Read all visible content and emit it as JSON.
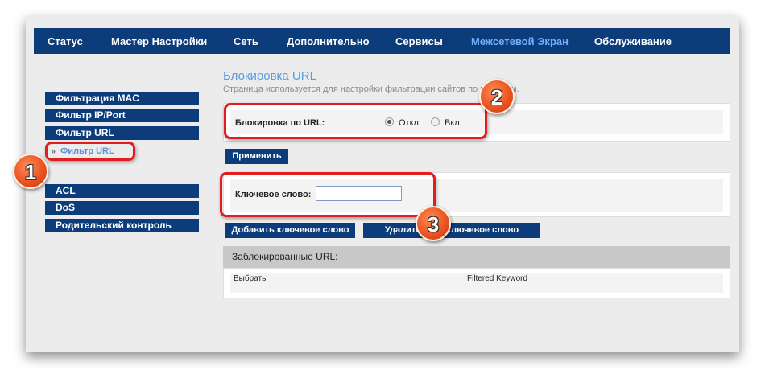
{
  "topnav": {
    "items": [
      {
        "label": "Статус"
      },
      {
        "label": "Мастер Настройки"
      },
      {
        "label": "Сеть"
      },
      {
        "label": "Дополнительно"
      },
      {
        "label": "Сервисы"
      },
      {
        "label": "Межсетевой Экран",
        "active": true
      },
      {
        "label": "Обслуживание"
      }
    ]
  },
  "sidebar": {
    "items": [
      {
        "label": "Фильтрация MAC"
      },
      {
        "label": "Фильтр IP/Port"
      },
      {
        "label": "Фильтр URL"
      },
      {
        "label": "ACL"
      },
      {
        "label": "DoS"
      },
      {
        "label": "Родительский контроль"
      }
    ],
    "subitem": {
      "bullet": "»",
      "label": "Фильтр URL"
    }
  },
  "page": {
    "title": "Блокировка URL",
    "description": "Страница используется для настройки фильтрации сайтов по к          словам."
  },
  "url_block": {
    "label": "Блокировка по URL:",
    "off_label": "Откл.",
    "on_label": "Вкл.",
    "selected": "off"
  },
  "apply_button": "Применить",
  "keyword": {
    "label": "Ключевое слово:",
    "value": ""
  },
  "add_button": "Добавить ключевое слово",
  "delete_button": "Удалить вы          е ключевое слово",
  "blocked": {
    "header": "Заблокированные URL:",
    "columns": [
      "Выбрать",
      "Filtered Keyword"
    ]
  },
  "markers": [
    "1",
    "2",
    "3"
  ],
  "colors": {
    "nav_bg": "#0c3c7a",
    "active_nav": "#6fb0ff",
    "title": "#5b9be0",
    "highlight": "#e01e1e",
    "marker": "#e8501e"
  }
}
